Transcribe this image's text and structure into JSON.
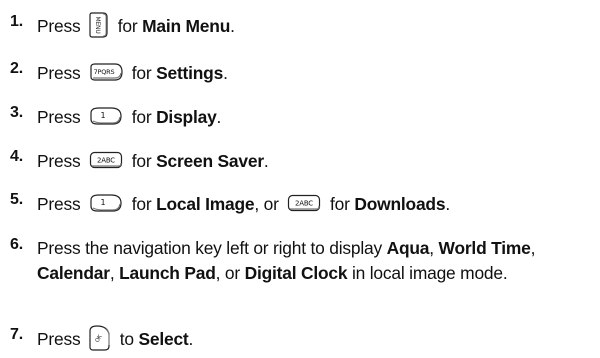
{
  "steps": [
    {
      "number": "1.",
      "parts": [
        "Press",
        "for",
        "Main Menu",
        "."
      ],
      "key_icon": "menu-key-icon"
    },
    {
      "number": "2.",
      "parts": [
        "Press",
        "for",
        "Settings",
        "."
      ],
      "key_icon": "7pqrs-key-icon",
      "key_label": "7PQRS"
    },
    {
      "number": "3.",
      "parts": [
        "Press",
        "for",
        "Display",
        "."
      ],
      "key_icon": "1-key-icon",
      "key_label": "1"
    },
    {
      "number": "4.",
      "parts": [
        "Press",
        "for",
        "Screen Saver",
        "."
      ],
      "key_icon": "2abc-key-icon",
      "key_label": "2ABC"
    },
    {
      "number": "5.",
      "parts": [
        "Press",
        "for",
        "Local Image",
        ", or",
        "for",
        "Downloads",
        "."
      ],
      "key_icons": [
        "1-key-icon",
        "2abc-key-icon"
      ]
    },
    {
      "number": "6.",
      "parts": [
        "Press the navigation key left or right to display ",
        "Aqua",
        ", ",
        "World Time",
        ", ",
        "Calendar",
        ", ",
        "Launch Pad",
        ", or ",
        "Digital Clock",
        " in local image mode."
      ]
    },
    {
      "number": "7.",
      "parts": [
        "Press",
        "to",
        "Select",
        "."
      ],
      "key_icon": "ok-key-icon"
    }
  ]
}
